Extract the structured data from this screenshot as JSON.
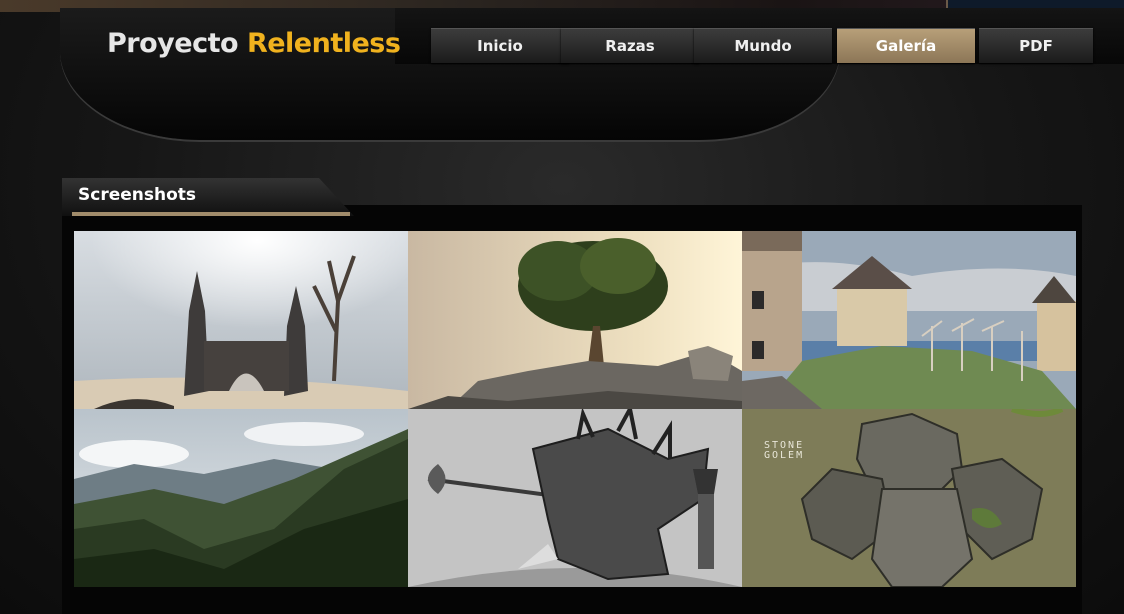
{
  "header": {
    "logo_part1": "Proyecto",
    "logo_part2": "Relentless",
    "nav": [
      {
        "label": "Inicio"
      },
      {
        "label": "Razas"
      },
      {
        "label": "Mundo"
      },
      {
        "label": "Galería",
        "active": true
      },
      {
        "label": "PDF"
      }
    ]
  },
  "gallery": {
    "title": "Screenshots",
    "images": [
      {
        "subject": "castle-ruins-screenshot"
      },
      {
        "subject": "tree-on-rock-screenshot"
      },
      {
        "subject": "village-houses-screenshot"
      },
      {
        "subject": "mountain-valley-screenshot"
      },
      {
        "subject": "armored-rhino-warrior-sketch"
      },
      {
        "subject": "stone-golem-concept-art",
        "caption": "STONE GOLEM"
      }
    ]
  },
  "colors": {
    "accent": "#f0b21e",
    "active_tab": "#a18c6b"
  }
}
